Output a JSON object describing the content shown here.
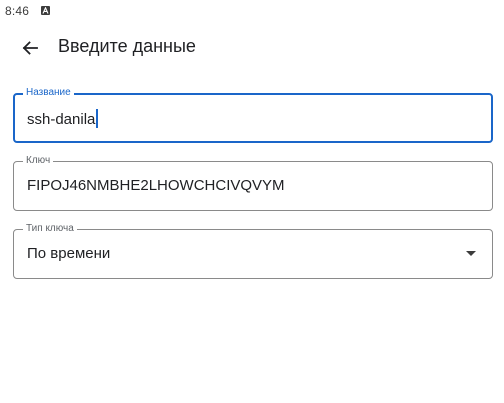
{
  "status_bar": {
    "time": "8:46",
    "notification_icon": "a-square-icon"
  },
  "app_bar": {
    "back_icon": "arrow-left-icon",
    "title": "Введите данные"
  },
  "form": {
    "name_field": {
      "label": "Название",
      "value": "ssh-danila"
    },
    "key_field": {
      "label": "Ключ",
      "value": "FIPOJ46NMBHE2LHOWCHCIVQVYM"
    },
    "key_type_field": {
      "label": "Тип ключа",
      "value": "По времени"
    }
  },
  "colors": {
    "accent": "#1a66c9",
    "outline": "#8a8a8a",
    "text": "#202124"
  }
}
